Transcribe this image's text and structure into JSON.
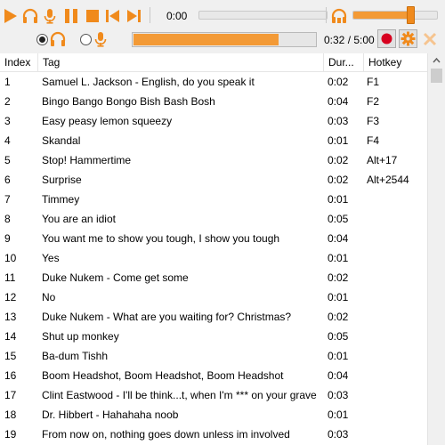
{
  "toolbar": {
    "time_label": "0:00",
    "volume_level": 0.68,
    "progress_label": "0:32 / 5:00",
    "progress_fraction": 0.8,
    "accent_color": "#f08a1c",
    "record_color": "#d7001f",
    "icons": [
      "play-icon",
      "headphones-icon",
      "microphone-icon",
      "pause-icon",
      "stop-icon",
      "skip-back-icon",
      "skip-forward-icon",
      "headphones-mute-icon",
      "record-icon",
      "gear-icon",
      "close-icon"
    ]
  },
  "radios": {
    "selected": "headphones",
    "options": [
      "headphones",
      "microphone"
    ]
  },
  "table": {
    "columns": [
      "Index",
      "Tag",
      "Dur...",
      "Hotkey"
    ],
    "rows": [
      {
        "index": "1",
        "tag": "Samuel L. Jackson - English, do you speak it",
        "duration": "0:02",
        "hotkey": "F1"
      },
      {
        "index": "2",
        "tag": "Bingo Bango Bongo Bish Bash Bosh",
        "duration": "0:04",
        "hotkey": "F2"
      },
      {
        "index": "3",
        "tag": "Easy peasy lemon squeezy",
        "duration": "0:03",
        "hotkey": "F3"
      },
      {
        "index": "4",
        "tag": "Skandal",
        "duration": "0:01",
        "hotkey": "F4"
      },
      {
        "index": "5",
        "tag": "Stop! Hammertime",
        "duration": "0:02",
        "hotkey": "Alt+17"
      },
      {
        "index": "6",
        "tag": "Surprise",
        "duration": "0:02",
        "hotkey": "Alt+2544"
      },
      {
        "index": "7",
        "tag": "Timmey",
        "duration": "0:01",
        "hotkey": ""
      },
      {
        "index": "8",
        "tag": "You are an idiot",
        "duration": "0:05",
        "hotkey": ""
      },
      {
        "index": "9",
        "tag": "You want me to show you tough, I show you tough",
        "duration": "0:04",
        "hotkey": ""
      },
      {
        "index": "10",
        "tag": "Yes",
        "duration": "0:01",
        "hotkey": ""
      },
      {
        "index": "11",
        "tag": "Duke Nukem - Come get some",
        "duration": "0:02",
        "hotkey": ""
      },
      {
        "index": "12",
        "tag": "No",
        "duration": "0:01",
        "hotkey": ""
      },
      {
        "index": "13",
        "tag": "Duke Nukem - What are you waiting for? Christmas?",
        "duration": "0:02",
        "hotkey": ""
      },
      {
        "index": "14",
        "tag": "Shut up monkey",
        "duration": "0:05",
        "hotkey": ""
      },
      {
        "index": "15",
        "tag": "Ba-dum Tishh",
        "duration": "0:01",
        "hotkey": ""
      },
      {
        "index": "16",
        "tag": "Boom Headshot, Boom Headshot, Boom Headshot",
        "duration": "0:04",
        "hotkey": ""
      },
      {
        "index": "17",
        "tag": "Clint Eastwood - I'll be think...t, when I'm *** on your grave",
        "duration": "0:03",
        "hotkey": ""
      },
      {
        "index": "18",
        "tag": "Dr. Hibbert - Hahahaha noob",
        "duration": "0:01",
        "hotkey": ""
      },
      {
        "index": "19",
        "tag": "From now on, nothing goes down unless im involved",
        "duration": "0:03",
        "hotkey": ""
      }
    ]
  }
}
